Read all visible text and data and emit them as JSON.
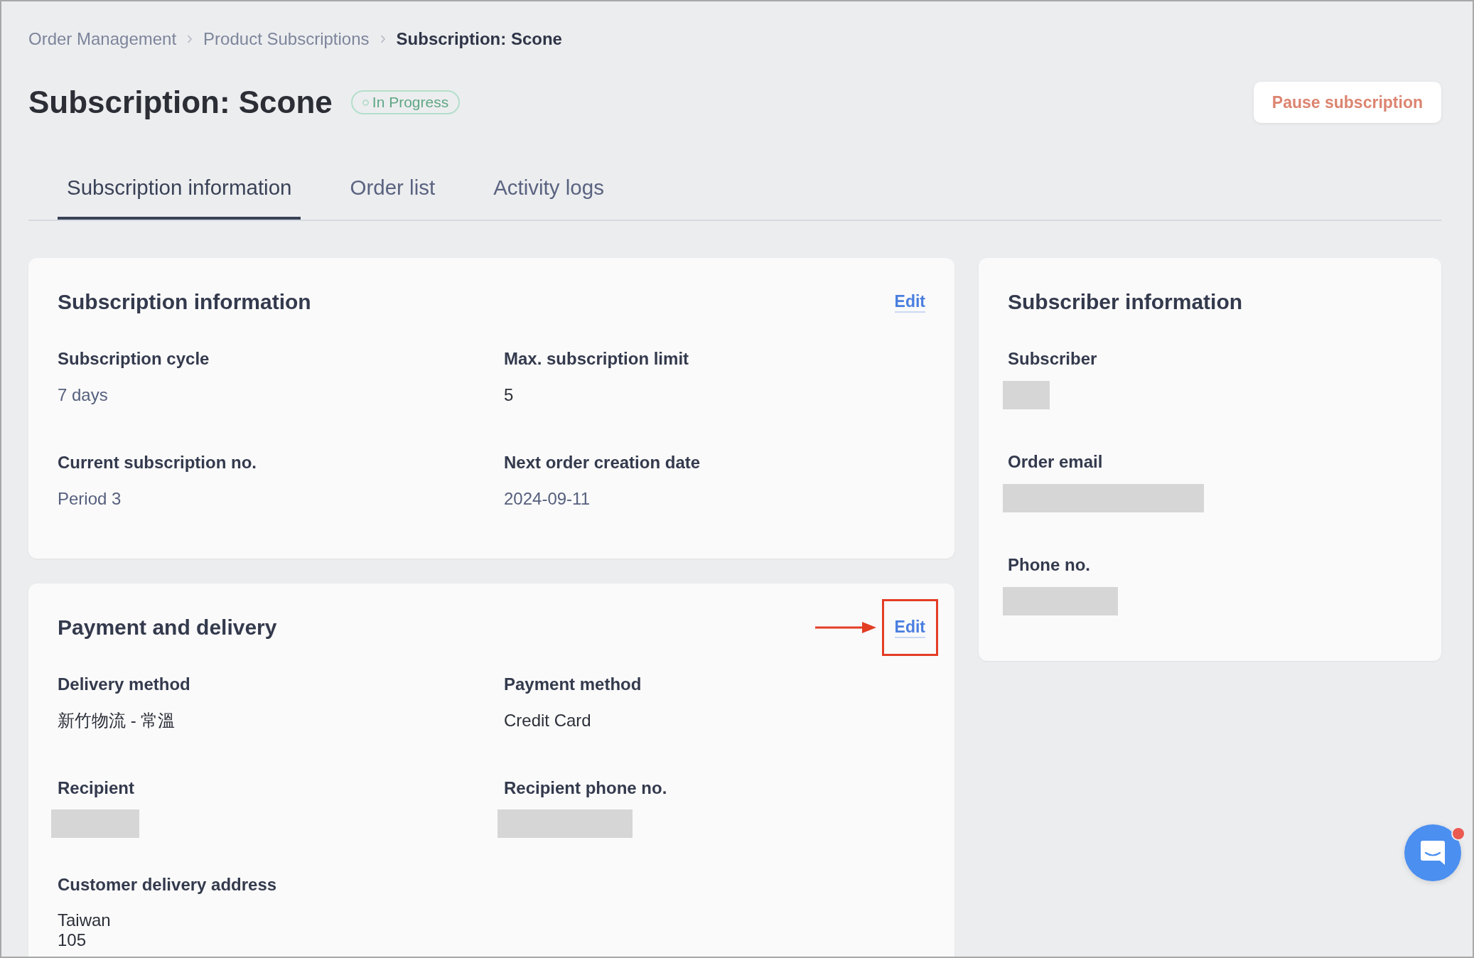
{
  "breadcrumb": [
    {
      "label": "Order Management",
      "current": false
    },
    {
      "label": "Product Subscriptions",
      "current": false
    },
    {
      "label": "Subscription: Scone",
      "current": true
    }
  ],
  "header": {
    "title": "Subscription: Scone",
    "status": {
      "label": "In Progress"
    },
    "action": {
      "label": "Pause subscription"
    }
  },
  "tabs": [
    {
      "label": "Subscription information",
      "selected": true
    },
    {
      "label": "Order list",
      "selected": false
    },
    {
      "label": "Activity logs",
      "selected": false
    }
  ],
  "main_sections": [
    {
      "title": "Subscription information",
      "edit": {
        "label": "Edit",
        "highlighted": false
      },
      "fields": [
        {
          "label": "Subscription cycle",
          "kind": "text",
          "value": "7 days",
          "color": "#56607e"
        },
        {
          "label": "Max. subscription limit",
          "kind": "text",
          "value": "5",
          "color": "#2b2f38"
        },
        {
          "label": "Current subscription no.",
          "kind": "text",
          "value": "Period 3",
          "color": "#56607e"
        },
        {
          "label": "Next order creation date",
          "kind": "text",
          "value": "2024-09-11",
          "color": "#56607e"
        }
      ]
    },
    {
      "title": "Payment and delivery",
      "edit": {
        "label": "Edit",
        "highlighted": true
      },
      "fields": [
        {
          "label": "Delivery method",
          "kind": "text",
          "value": "新竹物流 - 常溫",
          "color": "#2b2f38"
        },
        {
          "label": "Payment method",
          "kind": "text",
          "value": "Credit Card",
          "color": "#2b2f38"
        },
        {
          "label": "Recipient",
          "kind": "redacted"
        },
        {
          "label": "Recipient phone no.",
          "kind": "redacted"
        },
        {
          "label": "Customer delivery address",
          "kind": "lines",
          "lines": [
            "Taiwan",
            "105"
          ]
        }
      ]
    }
  ],
  "subscriber_section": {
    "title": "Subscriber information",
    "fields": [
      {
        "label": "Subscriber",
        "kind": "redacted"
      },
      {
        "label": "Order email",
        "kind": "redacted"
      },
      {
        "label": "Phone no.",
        "kind": "redacted"
      }
    ]
  },
  "chat_launcher": {
    "unread": true
  }
}
